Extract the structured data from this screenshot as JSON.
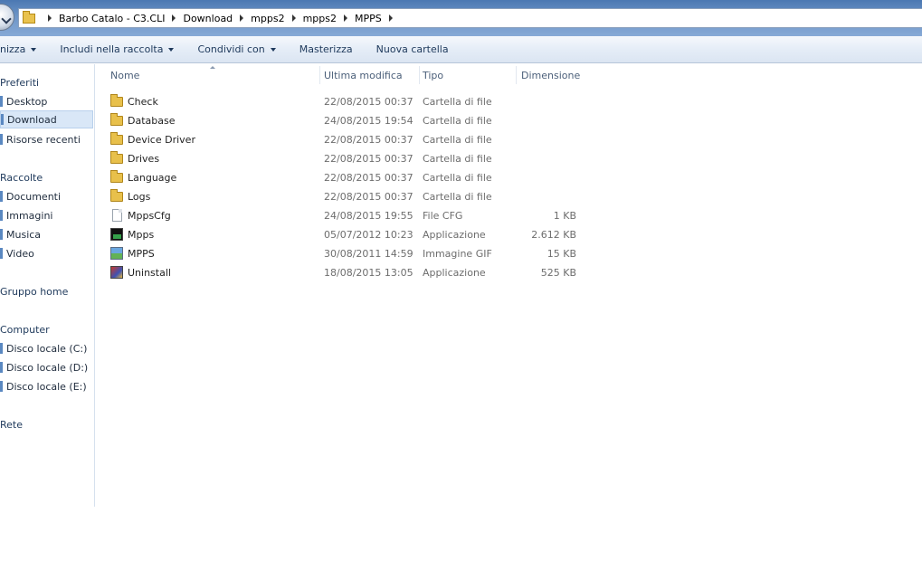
{
  "address_bar": {
    "crumbs": [
      "Barbo Catalo - C3.CLI",
      "Download",
      "mpps2",
      "mpps2",
      "MPPS"
    ]
  },
  "command_bar": {
    "organize": "nizza",
    "include": "Includi nella raccolta",
    "share": "Condividi con",
    "burn": "Masterizza",
    "new_folder": "Nuova cartella"
  },
  "nav": {
    "favorites": "Preferiti",
    "desktop": "Desktop",
    "downloads": "Download",
    "recent": "Risorse recenti",
    "libraries": "Raccolte",
    "documents": "Documenti",
    "images": "Immagini",
    "music": "Musica",
    "video": "Video",
    "homegroup": "Gruppo home",
    "computer": "Computer",
    "disk_c": "Disco locale (C:)",
    "disk_d": "Disco locale (D:)",
    "disk_e": "Disco locale (E:)",
    "network": "Rete"
  },
  "columns": {
    "name": "Nome",
    "modified": "Ultima modifica",
    "type": "Tipo",
    "size": "Dimensione"
  },
  "files": [
    {
      "name": "Check",
      "modified": "22/08/2015 00:37",
      "type": "Cartella di file",
      "size": "",
      "icon": "folder-icon"
    },
    {
      "name": "Database",
      "modified": "24/08/2015 19:54",
      "type": "Cartella di file",
      "size": "",
      "icon": "folder-icon"
    },
    {
      "name": "Device Driver",
      "modified": "22/08/2015 00:37",
      "type": "Cartella di file",
      "size": "",
      "icon": "folder-icon"
    },
    {
      "name": "Drives",
      "modified": "22/08/2015 00:37",
      "type": "Cartella di file",
      "size": "",
      "icon": "folder-icon"
    },
    {
      "name": "Language",
      "modified": "22/08/2015 00:37",
      "type": "Cartella di file",
      "size": "",
      "icon": "folder-icon"
    },
    {
      "name": "Logs",
      "modified": "22/08/2015 00:37",
      "type": "Cartella di file",
      "size": "",
      "icon": "folder-icon"
    },
    {
      "name": "MppsCfg",
      "modified": "24/08/2015 19:55",
      "type": "File CFG",
      "size": "1 KB",
      "icon": "cfg-file-icon"
    },
    {
      "name": "Mpps",
      "modified": "05/07/2012 10:23",
      "type": "Applicazione",
      "size": "2.612 KB",
      "icon": "app-icon"
    },
    {
      "name": "MPPS",
      "modified": "30/08/2011 14:59",
      "type": "Immagine GIF",
      "size": "15 KB",
      "icon": "gif-image-icon"
    },
    {
      "name": "Uninstall",
      "modified": "18/08/2015 13:05",
      "type": "Applicazione",
      "size": "525 KB",
      "icon": "uninstall-icon"
    }
  ]
}
